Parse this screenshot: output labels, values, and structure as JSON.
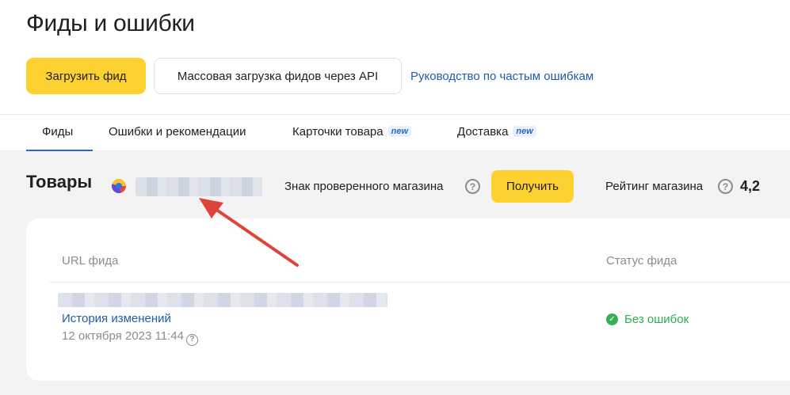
{
  "header": {
    "title": "Фиды и ошибки",
    "upload_feed_label": "Загрузить фид",
    "bulk_upload_label": "Массовая загрузка фидов через API",
    "guide_link_label": "Руководство по частым ошибкам"
  },
  "tabs": [
    {
      "label": "Фиды",
      "active": true
    },
    {
      "label": "Ошибки и рекомендации",
      "active": false
    },
    {
      "label": "Карточки товара",
      "badge": "new",
      "active": false
    },
    {
      "label": "Доставка",
      "badge": "new",
      "active": false
    }
  ],
  "goods": {
    "title": "Товары",
    "verified_label": "Знак проверенного магазина",
    "get_button_label": "Получить",
    "rating_label": "Рейтинг магазина",
    "rating_value": "4,2"
  },
  "feed_table": {
    "columns": [
      "URL фида",
      "Статус фида"
    ],
    "rows": [
      {
        "history_label": "История изменений",
        "date": "12 октября 2023 11:44",
        "status": "Без ошибок"
      }
    ]
  },
  "icons": {
    "help": "?",
    "ok": "✓"
  },
  "colors": {
    "accent_yellow": "#fdd12f",
    "link_blue": "#1f5bb0",
    "active_tab": "#2a6ad6",
    "status_ok": "#35b155",
    "annotation_arrow": "#e0433a"
  }
}
